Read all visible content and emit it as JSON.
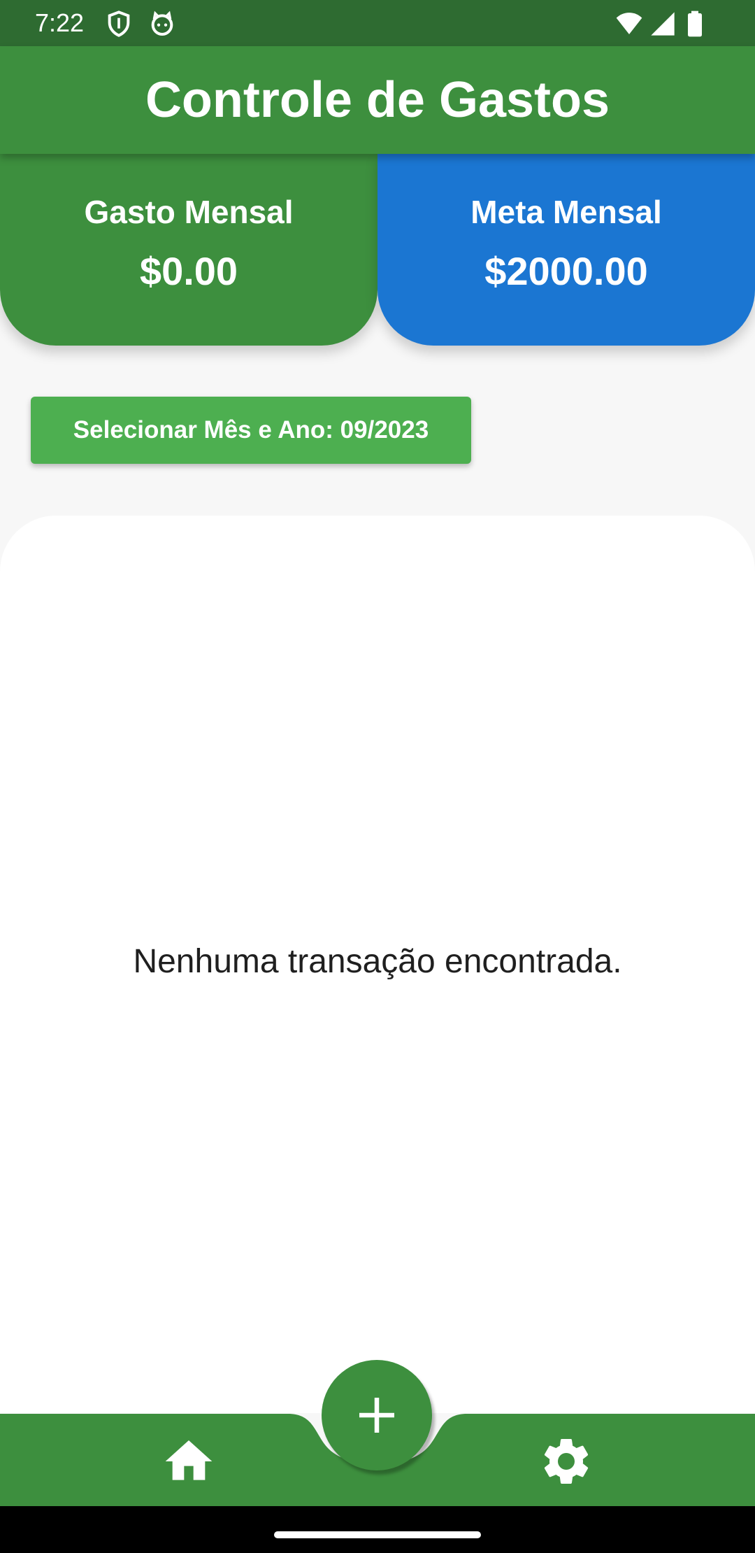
{
  "status_bar": {
    "time": "7:22",
    "icons": [
      "shield-icon",
      "cat-face-icon",
      "wifi-icon",
      "signal-icon",
      "battery-icon"
    ]
  },
  "app_bar": {
    "title": "Controle de Gastos"
  },
  "summary": {
    "spent": {
      "label": "Gasto Mensal",
      "value": "$0.00"
    },
    "goal": {
      "label": "Meta Mensal",
      "value": "$2000.00"
    }
  },
  "filter": {
    "select_label": "Selecionar Mês e Ano: 09/2023"
  },
  "transactions": {
    "empty_message": "Nenhuma transação encontrada."
  },
  "bottom_nav": {
    "items": [
      "home-icon",
      "gear-icon"
    ],
    "fab_icon": "plus-icon"
  },
  "colors": {
    "status_bar": "#2e6b31",
    "primary_green": "#3d8f3e",
    "button_green": "#4daf50",
    "goal_blue": "#1b76d2",
    "background": "#f7f7f7"
  }
}
